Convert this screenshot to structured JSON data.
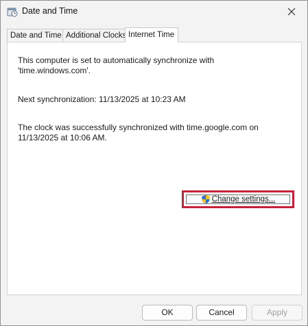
{
  "window": {
    "title": "Date and Time",
    "close_icon": "close-icon",
    "app_icon": "date-time-icon"
  },
  "tabs": [
    {
      "label": "Date and Time",
      "active": false
    },
    {
      "label": "Additional Clocks",
      "active": false
    },
    {
      "label": "Internet Time",
      "active": true
    }
  ],
  "internet_time": {
    "sync_line1": "This computer is set to automatically synchronize with",
    "sync_line2": "'time.windows.com'.",
    "next_sync": "Next synchronization: 11/13/2025 at 10:23 AM",
    "status_line1": "The clock was successfully synchronized with time.google.com on",
    "status_line2": "11/13/2025 at 10:06 AM.",
    "change_settings_label": "Change settings...",
    "change_settings_icon": "uac-shield-icon"
  },
  "footer": {
    "ok_label": "OK",
    "cancel_label": "Cancel",
    "apply_label": "Apply"
  },
  "colors": {
    "highlight": "#c6213a",
    "window_bg": "#f3f3f3",
    "panel_bg": "#ffffff"
  }
}
